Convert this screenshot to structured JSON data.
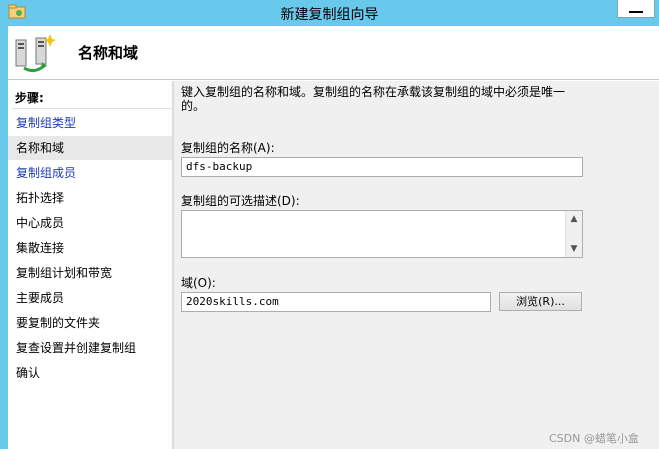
{
  "window": {
    "title": "新建复制组向导"
  },
  "header": {
    "title": "名称和域",
    "icon": "replication-group-icon"
  },
  "steps": {
    "title": "步骤:",
    "items": [
      {
        "label": "复制组类型",
        "state": "link"
      },
      {
        "label": "名称和域",
        "state": "current"
      },
      {
        "label": "复制组成员",
        "state": "link"
      },
      {
        "label": "拓扑选择",
        "state": "pending"
      },
      {
        "label": "中心成员",
        "state": "pending"
      },
      {
        "label": "集散连接",
        "state": "pending"
      },
      {
        "label": "复制组计划和带宽",
        "state": "pending"
      },
      {
        "label": "主要成员",
        "state": "pending"
      },
      {
        "label": "要复制的文件夹",
        "state": "pending"
      },
      {
        "label": "复查设置并创建复制组",
        "state": "pending"
      },
      {
        "label": "确认",
        "state": "pending"
      }
    ]
  },
  "main": {
    "intro": "键入复制组的名称和域。复制组的名称在承载该复制组的域中必须是唯一的。",
    "name_label": "复制组的名称(A):",
    "name_value": "dfs-backup",
    "desc_label": "复制组的可选描述(D):",
    "desc_value": "",
    "domain_label": "域(O):",
    "domain_value": "2020skills.com",
    "browse_label": "浏览(R)..."
  },
  "watermark": "CSDN @蜡笔小盒",
  "colors": {
    "titlebar": "#69c9ec",
    "link": "#1d3bb8",
    "panel": "#f0f0f0"
  }
}
